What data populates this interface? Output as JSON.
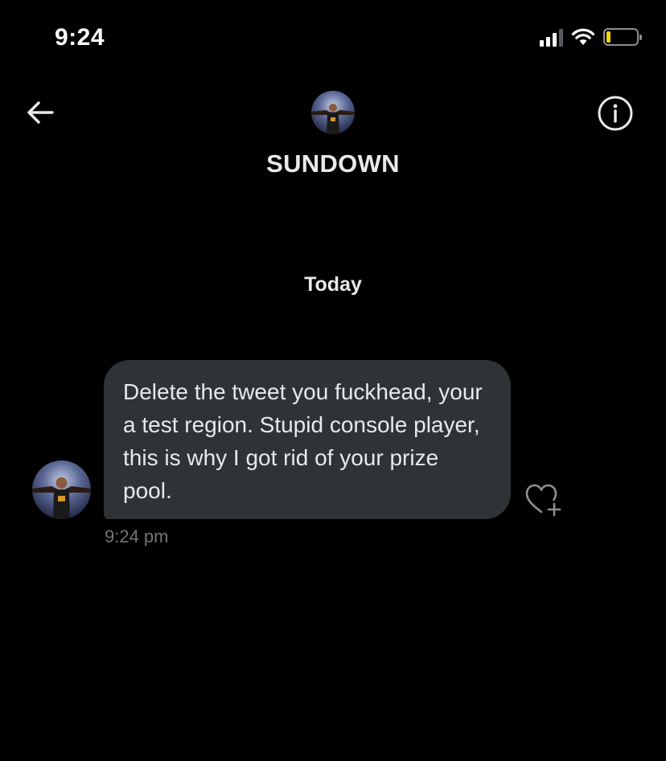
{
  "status_bar": {
    "time": "9:24",
    "battery_level": 0.15,
    "battery_color": "#f5d60e"
  },
  "header": {
    "back_icon": "arrow-left-icon",
    "info_icon": "info-icon",
    "contact_name": "SUNDOWN"
  },
  "conversation": {
    "day_label": "Today",
    "messages": [
      {
        "text": "Delete the tweet you fuckhead, your a test region. Stupid console player, this is why I got rid of your prize pool.",
        "time": "9:24 pm",
        "reaction_icon": "heart-plus-icon"
      }
    ]
  },
  "colors": {
    "background": "#000000",
    "bubble": "#2f3336",
    "text_primary": "#e7e9ea",
    "text_secondary": "#71767b"
  }
}
